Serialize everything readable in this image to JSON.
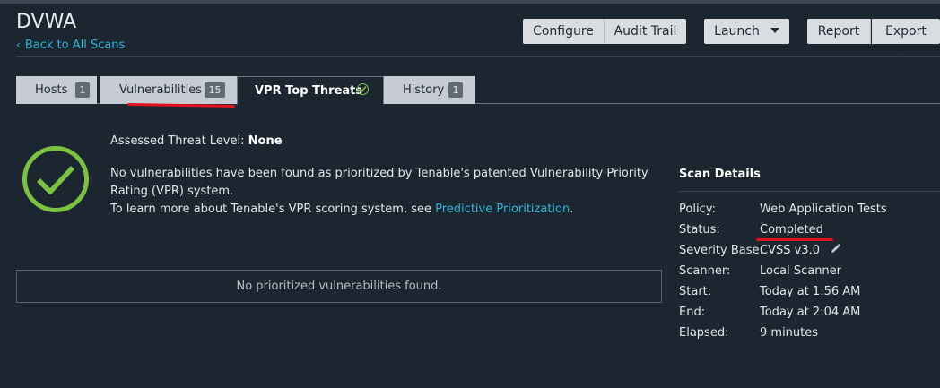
{
  "header": {
    "title": "DVWA",
    "back_label": "Back to All Scans"
  },
  "toolbar": {
    "configure": "Configure",
    "audit_trail": "Audit Trail",
    "launch": "Launch",
    "report": "Report",
    "export": "Export"
  },
  "tabs": [
    {
      "label": "Hosts",
      "count": "1"
    },
    {
      "label": "Vulnerabilities",
      "count": "15"
    },
    {
      "label": "VPR Top Threats"
    },
    {
      "label": "History",
      "count": "1"
    }
  ],
  "threat": {
    "level_label": "Assessed Threat Level:",
    "level_value": "None",
    "message_line1": "No vulnerabilities have been found as prioritized by Tenable's patented Vulnerability Priority",
    "message_line2": "Rating (VPR) system.",
    "learn_more": "To learn more about Tenable's VPR scoring system, see",
    "learn_more_link": "Predictive Prioritization",
    "learn_more_end": "."
  },
  "empty_state": "No prioritized vulnerabilities found.",
  "scan_details": {
    "title": "Scan Details",
    "rows": [
      {
        "key": "Policy:",
        "value": "Web Application Tests"
      },
      {
        "key": "Status:",
        "value": "Completed"
      },
      {
        "key": "Severity Base:",
        "value": "CVSS v3.0"
      },
      {
        "key": "Scanner:",
        "value": "Local Scanner"
      },
      {
        "key": "Start:",
        "value": "Today at 1:56 AM"
      },
      {
        "key": "End:",
        "value": "Today at 2:04 AM"
      },
      {
        "key": "Elapsed:",
        "value": "9 minutes"
      }
    ]
  },
  "colors": {
    "background": "#1c2630",
    "link": "#2bb5d6",
    "success": "#7cc242",
    "annotation": "#e0141e"
  },
  "icons": {
    "back": "chevron-left-icon",
    "launch": "caret-down-icon",
    "export": "caret-down-icon",
    "vpr_tab": "check-circle-icon",
    "threat": "check-circle-icon",
    "severity_edit": "pencil-icon"
  }
}
